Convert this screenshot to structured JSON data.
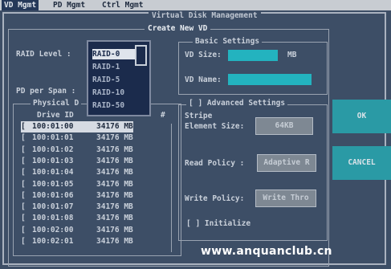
{
  "menu": {
    "items": [
      "VD Mgmt",
      "PD Mgmt",
      "Ctrl Mgmt"
    ],
    "active": "VD Mgmt"
  },
  "window_title": "Virtual Disk Management",
  "dialog_title": "Create New VD",
  "raid": {
    "label": "RAID Level :",
    "selected": "RAID-0",
    "options": [
      "RAID-0",
      "RAID-1",
      "RAID-5",
      "RAID-10",
      "RAID-50"
    ]
  },
  "pd_per_span_label": "PD per Span :",
  "physical_disks": {
    "title": "Physical D",
    "column_drive_id": "Drive ID",
    "column_hash": "#",
    "rows": [
      {
        "check": "[",
        "drive_id": "100:01:00",
        "size": "34176 MB"
      },
      {
        "check": "[",
        "drive_id": "100:01:01",
        "size": "34176 MB"
      },
      {
        "check": "[",
        "drive_id": "100:01:02",
        "size": "34176 MB"
      },
      {
        "check": "[",
        "drive_id": "100:01:03",
        "size": "34176 MB"
      },
      {
        "check": "[",
        "drive_id": "100:01:04",
        "size": "34176 MB"
      },
      {
        "check": "[",
        "drive_id": "100:01:05",
        "size": "34176 MB"
      },
      {
        "check": "[",
        "drive_id": "100:01:06",
        "size": "34176 MB"
      },
      {
        "check": "[",
        "drive_id": "100:01:07",
        "size": "34176 MB"
      },
      {
        "check": "[",
        "drive_id": "100:01:08",
        "size": "34176 MB"
      },
      {
        "check": "[",
        "drive_id": "100:02:00",
        "size": "34176 MB"
      },
      {
        "check": "[",
        "drive_id": "100:02:01",
        "size": "34176 MB"
      }
    ]
  },
  "basic_settings": {
    "title": "Basic Settings",
    "vd_size_label": "VD Size:",
    "vd_size_unit": "MB",
    "vd_name_label": "VD Name:"
  },
  "advanced_settings": {
    "title": "[ ] Advanced Settings",
    "stripe_label_1": "Stripe",
    "stripe_label_2": "Element Size:",
    "stripe_value": "64KB",
    "read_policy_label": "Read Policy :",
    "read_policy_value": "Adaptive R",
    "write_policy_label": "Write Policy:",
    "write_policy_value": "Write Thro",
    "initialize_label": "[ ] Initialize"
  },
  "buttons": {
    "ok": "OK",
    "cancel": "CANCEL"
  },
  "watermark": "www.anquanclub.cn",
  "colors": {
    "background": "#3d4e66",
    "field": "#23b3bf",
    "menubar": "#c8ccd2",
    "dropdown": "#1b2b4c"
  }
}
